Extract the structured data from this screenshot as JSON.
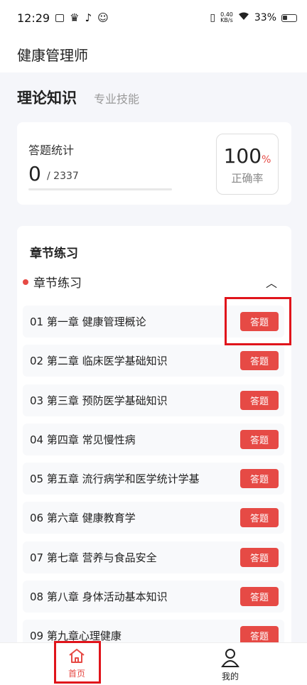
{
  "status": {
    "time": "12:29",
    "speed_top": "0.40",
    "speed_bottom": "KB/s",
    "battery": "33%"
  },
  "app": {
    "title": "健康管理师"
  },
  "tabs": {
    "active": "理论知识",
    "other": "专业技能"
  },
  "stats": {
    "label": "答题统计",
    "answered": "0",
    "total": "/ 2337",
    "rate_value": "100",
    "rate_unit": "%",
    "rate_label": "正确率"
  },
  "chapter": {
    "card_title": "章节练习",
    "section_label": "章节练习",
    "button_label": "答题",
    "rows": [
      "01   第一章   健康管理概论",
      "02   第二章   临床医学基础知识",
      "03   第三章   预防医学基础知识",
      "04   第四章   常见慢性病",
      "05   第五章   流行病学和医学统计学基",
      "06   第六章   健康教育学",
      "07   第七章   营养与食品安全",
      "08   第八章   身体活动基本知识",
      "09   第九章心理健康"
    ]
  },
  "nav": {
    "home": "首页",
    "mine": "我的"
  },
  "colors": {
    "accent": "#e64a45",
    "highlight": "#e0141b"
  }
}
